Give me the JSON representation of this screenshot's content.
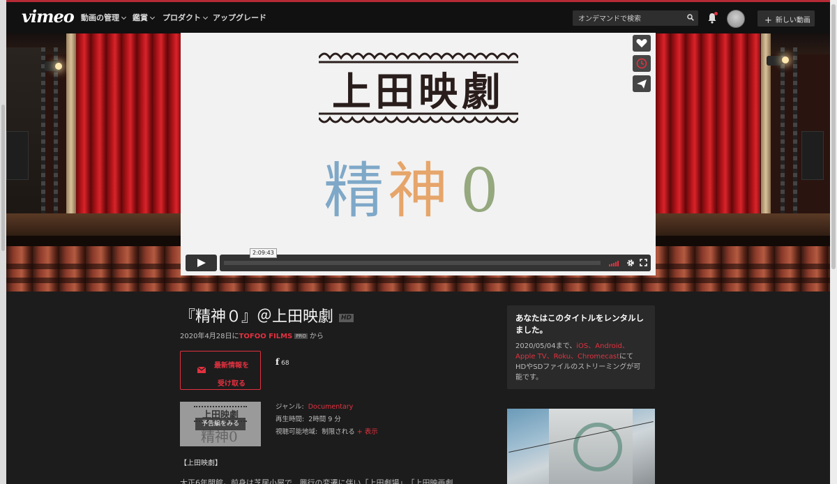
{
  "nav": {
    "logo": "vimeo",
    "items": [
      "動画の管理",
      "鑑賞",
      "プロダクト",
      "アップグレード"
    ],
    "search_placeholder": "オンデマンドで検索",
    "new_video_label": "新しい動画"
  },
  "player": {
    "logo_text": "上田映劇",
    "title_art": [
      "精",
      "神",
      "0"
    ],
    "time_tooltip": "2:09:43",
    "progress": 0,
    "side_buttons": [
      "like",
      "watch-later",
      "share"
    ]
  },
  "video": {
    "title": "『精神０』＠上田映劇",
    "hd_badge": "HD",
    "date_prefix": "2020年4月28日に",
    "channel": "TOFOO FILMS",
    "pro_badge": "PRO",
    "from_suffix": "から",
    "subscribe_line1": "最新情報を",
    "subscribe_line2": "受け取る",
    "facebook_count": "68",
    "trailer_label": "予告編をみる",
    "thumb_logo": "上田映劇",
    "thumb_art": "精神0",
    "genre_label": "ジャンル:",
    "genre_value": "Documentary",
    "runtime_label": "再生時間:",
    "runtime_value": "2時間 9 分",
    "region_label": "視聴可能地域:",
    "region_value": "制限される",
    "region_more": "+ 表示",
    "desc_heading": "【上田映劇】",
    "desc_line1": "大正6年開館。前身は芝居小屋で、興行の変遷に伴い「上田劇場」、「上田映画劇"
  },
  "rental": {
    "title": "あなたはこのタイトルをレンタルしました。",
    "body_prefix": "2020/05/04まで、",
    "platforms_1": "iOS、Android、",
    "platforms_2": "Apple TV、Roku、Chromecast",
    "body_suffix_1": "にて",
    "body_suffix_2": "HDやSDファイルのストリーミングが可能です。"
  },
  "colors": {
    "accent": "#e2313f",
    "nav_bg": "#111111",
    "page_bg": "#1c1c1c",
    "player_bg": "#f2f2f2"
  }
}
